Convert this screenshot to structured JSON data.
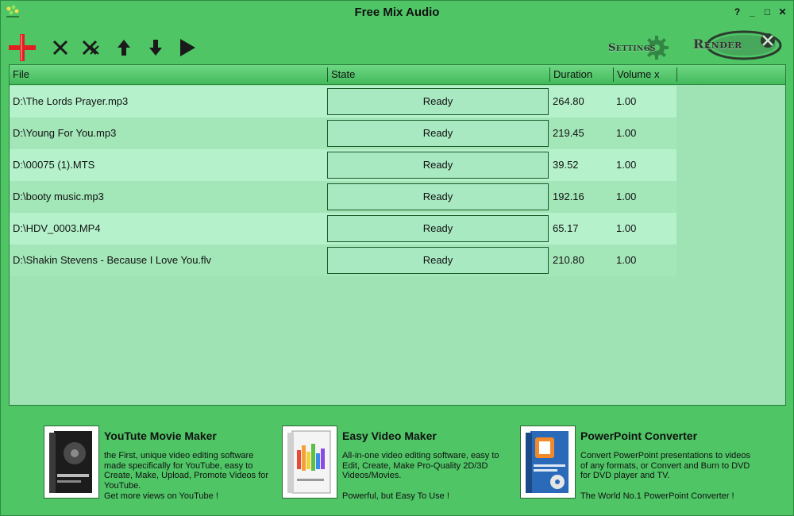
{
  "window": {
    "title": "Free Mix Audio"
  },
  "titlebar_buttons": [
    "?",
    "_",
    "□",
    "✕"
  ],
  "toolbar": {
    "settings_label": "Settings",
    "render_label": "Render"
  },
  "columns": [
    "File",
    "State",
    "Duration",
    "Volume x"
  ],
  "files": [
    {
      "file": "D:\\The Lords Prayer.mp3",
      "state": "Ready",
      "duration": "264.80",
      "volume": "1.00"
    },
    {
      "file": "D:\\Young For You.mp3",
      "state": "Ready",
      "duration": "219.45",
      "volume": "1.00"
    },
    {
      "file": "D:\\00075 (1).MTS",
      "state": "Ready",
      "duration": "39.52",
      "volume": "1.00"
    },
    {
      "file": "D:\\booty music.mp3",
      "state": "Ready",
      "duration": "192.16",
      "volume": "1.00"
    },
    {
      "file": "D:\\HDV_0003.MP4",
      "state": "Ready",
      "duration": "65.17",
      "volume": "1.00"
    },
    {
      "file": "D:\\Shakin Stevens - Because I Love You.flv",
      "state": "Ready",
      "duration": "210.80",
      "volume": "1.00"
    }
  ],
  "promos": [
    {
      "title": "YouTute Movie Maker",
      "desc": "the First, unique video editing software made specifically for YouTube, easy to Create, Make, Upload, Promote Videos for YouTube.",
      "tag": "Get more views on YouTube !"
    },
    {
      "title": "Easy Video Maker",
      "desc": "All-in-one video editing software, easy to Edit, Create, Make Pro-Quality 2D/3D Videos/Movies.",
      "tag": "Powerful, but Easy To Use !"
    },
    {
      "title": "PowerPoint Converter",
      "desc": "Convert PowerPoint presentations to videos of any formats, or Convert and Burn to DVD for DVD player and TV.",
      "tag": "The World No.1 PowerPoint Converter !"
    }
  ],
  "colors": {
    "background": "#4fc566",
    "list_row_light": "#b5f2cc",
    "list_row_dark": "#a3e6b8",
    "add_icon": "#e02020"
  }
}
